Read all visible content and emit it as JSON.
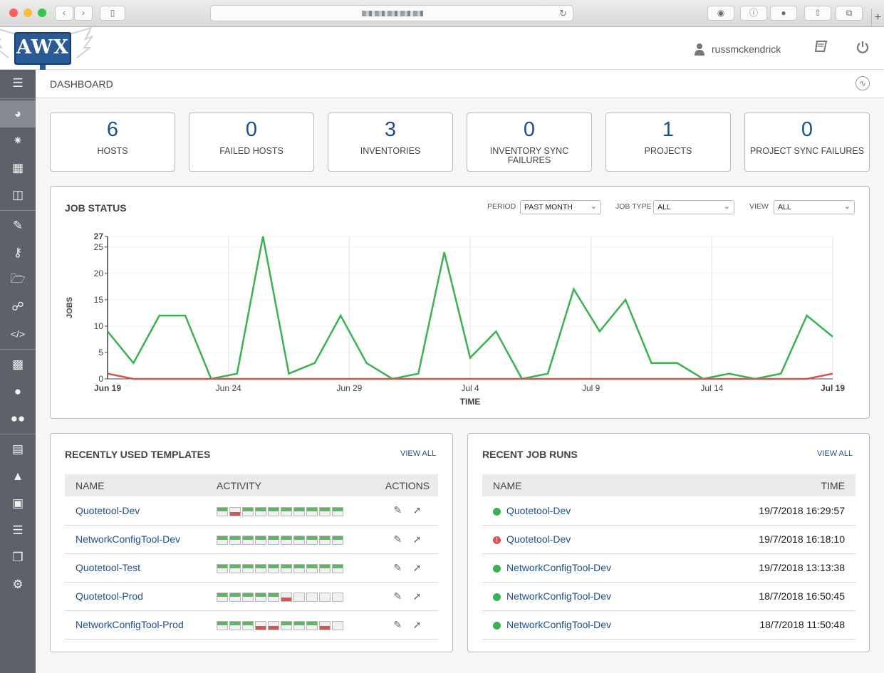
{
  "browser": {
    "plus": "+"
  },
  "header": {
    "logo_text": "AWX",
    "username": "russmckendrick"
  },
  "breadcrumb": "DASHBOARD",
  "cards": [
    {
      "value": "6",
      "label": "HOSTS"
    },
    {
      "value": "0",
      "label": "FAILED HOSTS"
    },
    {
      "value": "3",
      "label": "INVENTORIES"
    },
    {
      "value": "0",
      "label": "INVENTORY SYNC FAILURES"
    },
    {
      "value": "1",
      "label": "PROJECTS"
    },
    {
      "value": "0",
      "label": "PROJECT SYNC FAILURES"
    }
  ],
  "job_status": {
    "title": "JOB STATUS",
    "period_label": "PERIOD",
    "period_value": "PAST MONTH",
    "job_type_label": "JOB TYPE",
    "job_type_value": "ALL",
    "view_label": "VIEW",
    "view_value": "ALL"
  },
  "chart_data": {
    "type": "line",
    "xlabel": "TIME",
    "ylabel": "JOBS",
    "ylim": [
      0,
      27
    ],
    "yticks": [
      "0",
      "5",
      "10",
      "15",
      "20",
      "25",
      "27"
    ],
    "xticks": [
      "Jun 19",
      "Jun 24",
      "Jun 29",
      "Jul 4",
      "Jul 9",
      "Jul 14",
      "Jul 19"
    ],
    "x": [
      "Jun 19",
      "Jun 20",
      "Jun 21",
      "Jun 22",
      "Jun 23",
      "Jun 24",
      "Jun 25",
      "Jun 26",
      "Jun 27",
      "Jun 28",
      "Jun 29",
      "Jun 30",
      "Jul 1",
      "Jul 2",
      "Jul 3",
      "Jul 4",
      "Jul 8",
      "Jul 9",
      "Jul 10",
      "Jul 11",
      "Jul 12",
      "Jul 13",
      "Jul 14",
      "Jul 15",
      "Jul 16",
      "Jul 17",
      "Jul 18",
      "Jul 19"
    ],
    "series": [
      {
        "color": "#3cb054",
        "values": [
          9,
          3,
          12,
          12,
          0,
          1,
          27,
          1,
          3,
          12,
          3,
          0,
          1,
          24,
          4,
          9,
          0,
          1,
          17,
          9,
          15,
          3,
          3,
          0,
          1,
          0,
          1,
          12,
          8
        ]
      },
      {
        "color": "#d9534f",
        "values": [
          1,
          0,
          0,
          0,
          0,
          0,
          0,
          0,
          0,
          0,
          0,
          0,
          0,
          0,
          0,
          0,
          0,
          0,
          0,
          0,
          0,
          0,
          0,
          0,
          0,
          0,
          0,
          0,
          1
        ]
      }
    ],
    "grid": true
  },
  "templates": {
    "title": "RECENTLY USED TEMPLATES",
    "view_all": "VIEW ALL",
    "headers": [
      "NAME",
      "ACTIVITY",
      "ACTIONS"
    ],
    "rows": [
      {
        "name": "Quotetool-Dev",
        "activity": [
          "s",
          "f",
          "s",
          "s",
          "s",
          "s",
          "s",
          "s",
          "s",
          "s"
        ]
      },
      {
        "name": "NetworkConfigTool-Dev",
        "activity": [
          "s",
          "s",
          "s",
          "s",
          "s",
          "s",
          "s",
          "s",
          "s",
          "s"
        ]
      },
      {
        "name": "Quotetool-Test",
        "activity": [
          "s",
          "s",
          "s",
          "s",
          "s",
          "s",
          "s",
          "s",
          "s",
          "s"
        ]
      },
      {
        "name": "Quotetool-Prod",
        "activity": [
          "s",
          "s",
          "s",
          "s",
          "s",
          "f",
          "e",
          "e",
          "e",
          "e"
        ]
      },
      {
        "name": "NetworkConfigTool-Prod",
        "activity": [
          "s",
          "s",
          "s",
          "f",
          "f",
          "s",
          "s",
          "s",
          "f",
          "e"
        ]
      }
    ]
  },
  "recent_jobs": {
    "title": "RECENT JOB RUNS",
    "view_all": "VIEW ALL",
    "headers": [
      "NAME",
      "TIME"
    ],
    "rows": [
      {
        "name": "Quotetool-Dev",
        "time": "19/7/2018 16:29:57",
        "status": "success"
      },
      {
        "name": "Quotetool-Dev",
        "time": "19/7/2018 16:18:10",
        "status": "failed"
      },
      {
        "name": "NetworkConfigTool-Dev",
        "time": "19/7/2018 13:13:38",
        "status": "success"
      },
      {
        "name": "NetworkConfigTool-Dev",
        "time": "18/7/2018 16:50:45",
        "status": "success"
      },
      {
        "name": "NetworkConfigTool-Dev",
        "time": "18/7/2018 11:50:48",
        "status": "success"
      }
    ]
  }
}
